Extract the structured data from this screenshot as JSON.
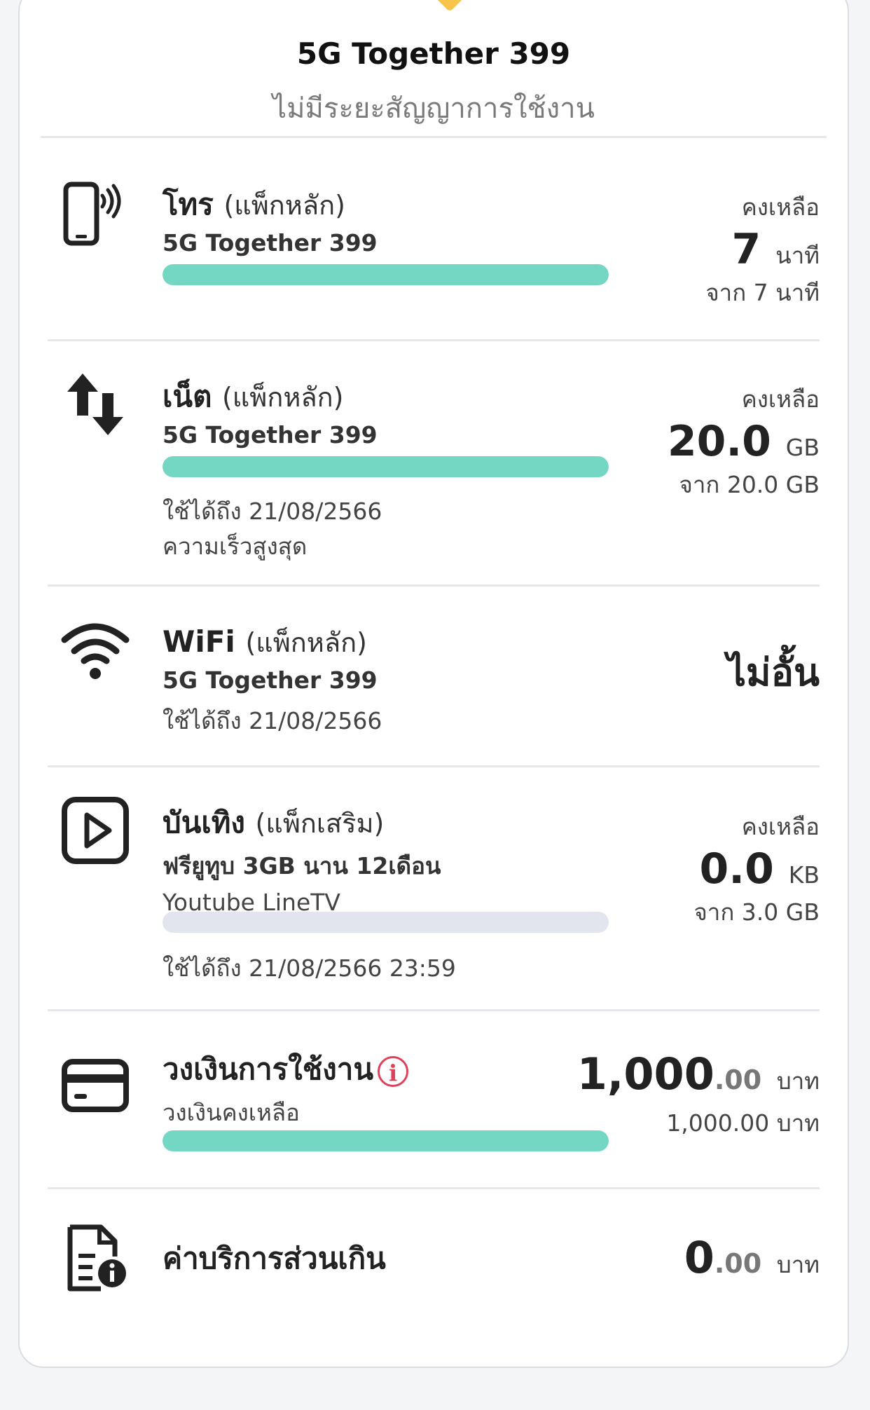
{
  "package": {
    "title": "5G Together 399",
    "subtitle": "ไม่มีระยะสัญญาการใช้งาน"
  },
  "call": {
    "title": "โทร",
    "tag": "(แพ็กหลัก)",
    "package": "5G Together 399",
    "remaining_label": "คงเหลือ",
    "remaining_value": "7",
    "remaining_unit": "นาที",
    "from_text": "จาก 7 นาที",
    "progress": 1.0
  },
  "net": {
    "title": "เน็ต",
    "tag": "(แพ็กหลัก)",
    "package": "5G Together 399",
    "valid_until": "ใช้ได้ถึง 21/08/2566",
    "speed": "ความเร็วสูงสุด",
    "remaining_label": "คงเหลือ",
    "remaining_value": "20.0",
    "remaining_unit": "GB",
    "from_text": "จาก 20.0 GB",
    "progress": 1.0
  },
  "wifi": {
    "title": "WiFi",
    "tag": "(แพ็กหลัก)",
    "package": "5G Together 399",
    "valid_until": "ใช้ได้ถึง 21/08/2566",
    "status": "ไม่อั้น"
  },
  "entertainment": {
    "title": "บันเทิง",
    "tag": "(แพ็กเสริม)",
    "package": "ฟรียูทูบ 3GB นาน 12เดือน",
    "apps": "Youtube LineTV",
    "valid_until": "ใช้ได้ถึง 21/08/2566 23:59",
    "remaining_label": "คงเหลือ",
    "remaining_value": "0.0",
    "remaining_unit": "KB",
    "from_text": "จาก 3.0 GB",
    "progress": 0.0
  },
  "credit": {
    "title": "วงเงินการใช้งาน",
    "subtitle": "วงเงินคงเหลือ",
    "value_int": "1,000",
    "value_dec": ".00",
    "unit": "บาท",
    "total_text": "1,000.00 บาท",
    "info_glyph": "i",
    "progress": 1.0
  },
  "overage": {
    "title": "ค่าบริการส่วนเกิน",
    "value_int": "0",
    "value_dec": ".00",
    "unit": "บาท"
  },
  "colors": {
    "accent_bar": "#74d7c4",
    "bar_track": "#e3e5ee",
    "info_red": "#e0415a",
    "top_tab": "#f6c54a"
  },
  "icons": [
    "phone-signal-icon",
    "data-transfer-icon",
    "wifi-icon",
    "play-icon",
    "credit-card-icon",
    "document-info-icon"
  ]
}
